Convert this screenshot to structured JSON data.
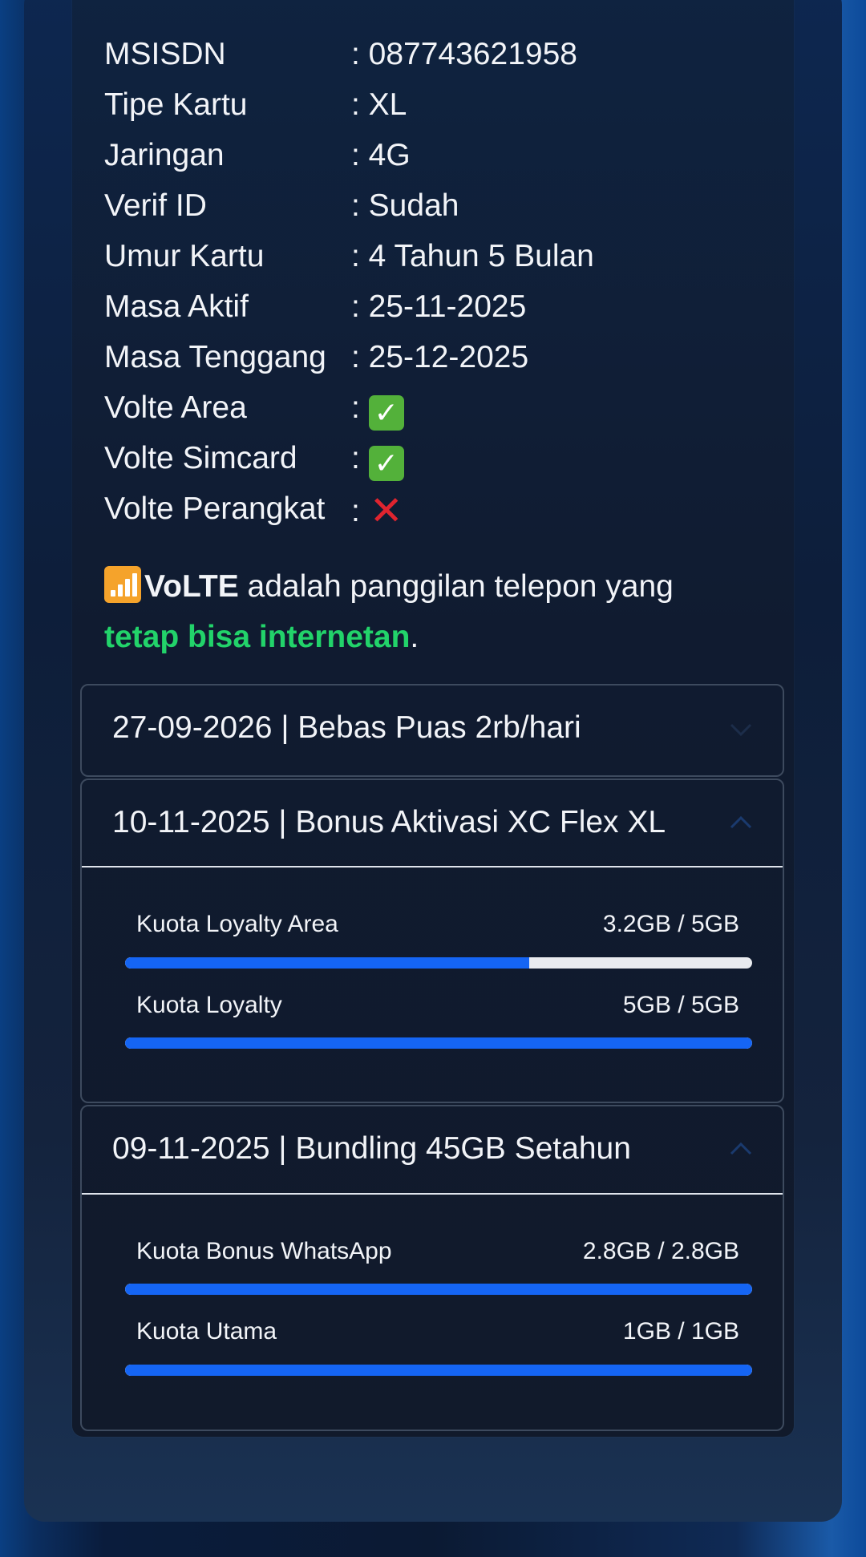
{
  "info": [
    {
      "label": "MSISDN",
      "value": ": 087743621958"
    },
    {
      "label": "Tipe Kartu",
      "value": ": XL"
    },
    {
      "label": "Jaringan",
      "value": ": 4G"
    },
    {
      "label": "Verif ID",
      "value": ": Sudah"
    },
    {
      "label": "Umur Kartu",
      "value": ": 4 Tahun 5 Bulan"
    },
    {
      "label": "Masa Aktif",
      "value": ": 25-11-2025"
    },
    {
      "label": "Masa Tenggang",
      "value": ": 25-12-2025"
    },
    {
      "label": "Volte Area",
      "value": ":",
      "status": "check"
    },
    {
      "label": "Volte Simcard",
      "value": ":",
      "status": "check"
    },
    {
      "label": "Volte Perangkat",
      "value": ":",
      "status": "cross"
    }
  ],
  "volte_note": {
    "icon": "signal-bars-icon",
    "bold": "VoLTE",
    "text": " adalah panggilan telepon yang",
    "highlight": "tetap bisa internetan",
    "end": "."
  },
  "packages": [
    {
      "title": "27-09-2026 | Bebas Puas 2rb/hari",
      "expanded": false,
      "quotas": []
    },
    {
      "title": "10-11-2025 | Bonus Aktivasi XC Flex XL",
      "expanded": true,
      "quotas": [
        {
          "label": "Kuota Loyalty Area",
          "value": "3.2GB / 5GB",
          "fraction": 0.645
        },
        {
          "label": "Kuota Loyalty",
          "value": "5GB / 5GB",
          "fraction": 1.0
        }
      ]
    },
    {
      "title": "09-11-2025 | Bundling 45GB Setahun",
      "expanded": true,
      "quotas": [
        {
          "label": "Kuota Bonus WhatsApp",
          "value": "2.8GB / 2.8GB",
          "fraction": 1.0
        },
        {
          "label": "Kuota Utama",
          "value": "1GB / 1GB",
          "fraction": 1.0
        }
      ]
    }
  ],
  "colors": {
    "accent_blue": "#1565f4",
    "highlight_green": "#22d36a",
    "check_green": "#53b13a",
    "cross_red": "#e0242f"
  }
}
